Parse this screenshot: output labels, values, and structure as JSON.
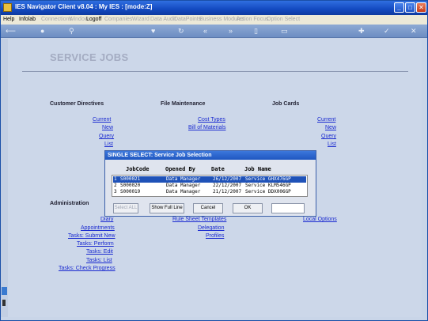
{
  "window": {
    "title": "IES Navigator Client v8.04 : My IES :      [mode:Z]"
  },
  "menu": [
    {
      "label": "Help",
      "dim": false
    },
    {
      "label": "Infolab",
      "dim": false
    },
    {
      "label": "Connections",
      "dim": true
    },
    {
      "label": "Window",
      "dim": true
    },
    {
      "label": "Logoff",
      "dim": false
    },
    {
      "label": "Companies",
      "dim": true
    },
    {
      "label": "Wizard",
      "dim": true
    },
    {
      "label": "Data Audit",
      "dim": true
    },
    {
      "label": "DataPoints",
      "dim": true
    },
    {
      "label": "Business Modules",
      "dim": true
    },
    {
      "label": "Action Focus",
      "dim": true
    },
    {
      "label": "Option Select",
      "dim": true
    }
  ],
  "toolbar_icons": [
    "back-icon",
    "info-icon",
    "search-icon",
    "heart-icon",
    "refresh-icon",
    "rewind-icon",
    "fast-forward-icon",
    "clipboard-icon",
    "document-icon",
    "settings-icon",
    "check-icon",
    "close-icon"
  ],
  "page": {
    "title": "SERVICE JOBS"
  },
  "sections": {
    "customer_directives": {
      "heading": "Customer Directives",
      "links": [
        "Current",
        "New",
        "Query",
        "List"
      ]
    },
    "file_maintenance": {
      "heading": "File Maintenance",
      "links": [
        "Cost Types",
        "Bill of Materials"
      ]
    },
    "job_cards": {
      "heading": "Job Cards",
      "links": [
        "Current",
        "New",
        "Query",
        "List"
      ]
    },
    "administration": {
      "heading": "Administration",
      "links": [
        "Diary",
        "Appointments",
        "Tasks: Submit New",
        "Tasks: Perform",
        "Tasks: Edit",
        "Tasks: List",
        "Tasks: Check Progress"
      ]
    },
    "middle_links": [
      "Rule Sheet Templates",
      "Delegation",
      "Profiles"
    ],
    "right_links": [
      "Local Options"
    ]
  },
  "dialog": {
    "title": "SINGLE SELECT: Service Job Selection",
    "columns": [
      "JobCode",
      "Opened By",
      "Date",
      "Job Name"
    ],
    "rows": [
      {
        "n": "1",
        "code": "S000021",
        "by": "Data Manager",
        "date": "26/12/2007",
        "name": "Service GHX476GP"
      },
      {
        "n": "2",
        "code": "S000020",
        "by": "Data Manager",
        "date": "22/12/2007",
        "name": "Service KLM546GP"
      },
      {
        "n": "3",
        "code": "S000019",
        "by": "Data Manager",
        "date": "21/12/2007",
        "name": "Service DDX006GP"
      }
    ],
    "selected_row": 0,
    "buttons": {
      "select_all": "Select ALL",
      "show_full_line": "Show Full Line",
      "cancel": "Cancel",
      "ok": "OK"
    },
    "input_value": ""
  }
}
